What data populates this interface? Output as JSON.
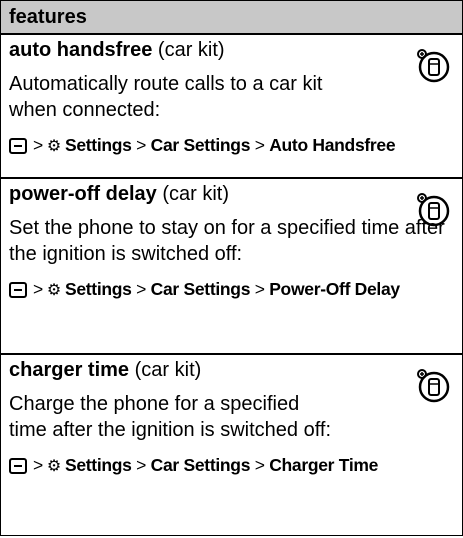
{
  "table": {
    "header": "features",
    "rows": [
      {
        "title_bold": "auto handsfree",
        "title_suffix": "(car kit)",
        "desc": "Automatically route calls to a car kit when connected:",
        "path": {
          "settings": "Settings",
          "car_settings": "Car Settings",
          "target": "Auto Handsfree"
        }
      },
      {
        "title_bold": "power-off delay",
        "title_suffix": "(car kit)",
        "desc": "Set the phone to stay on for a specified time after the ignition is switched off:",
        "path": {
          "settings": "Settings",
          "car_settings": "Car Settings",
          "target": "Power-Off Delay"
        }
      },
      {
        "title_bold": "charger time",
        "title_suffix": "(car kit)",
        "desc": "Charge the phone for a specified time after the ignition is switched off:",
        "path": {
          "settings": "Settings",
          "car_settings": "Car Settings",
          "target": "Charger Time"
        }
      }
    ]
  },
  "icons": {
    "menu_key": "menu-key-icon",
    "settings": "settings-icon",
    "feature": "network-feature-icon"
  },
  "separator": ">"
}
